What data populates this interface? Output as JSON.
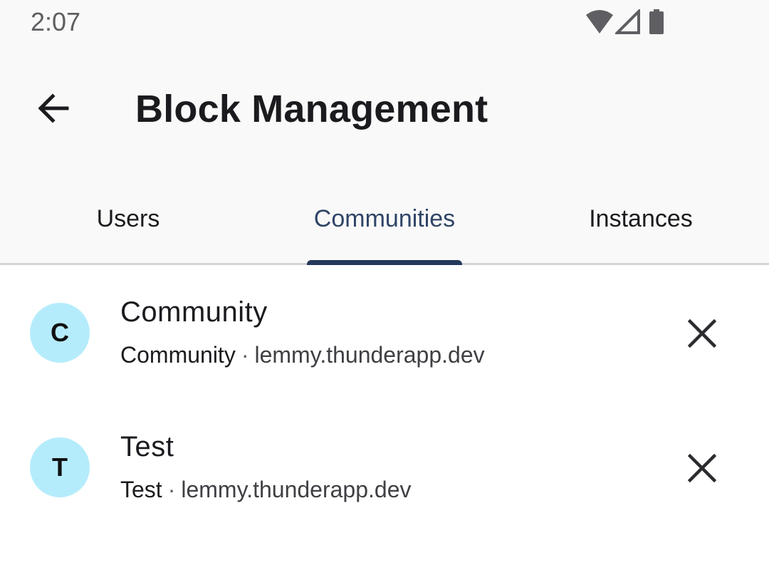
{
  "status_bar": {
    "time": "2:07",
    "icons": [
      "wifi-icon",
      "cellular-signal-icon",
      "battery-icon"
    ]
  },
  "app_bar": {
    "title": "Block Management",
    "back_icon": "arrow-back-icon"
  },
  "tabs": [
    {
      "label": "Users",
      "active": false
    },
    {
      "label": "Communities",
      "active": true
    },
    {
      "label": "Instances",
      "active": false
    }
  ],
  "blocked_communities": [
    {
      "avatar_letter": "C",
      "title": "Community",
      "name": "Community",
      "separator": "·",
      "instance": "lemmy.thunderapp.dev",
      "remove_icon": "close-icon"
    },
    {
      "avatar_letter": "T",
      "title": "Test",
      "name": "Test",
      "separator": "·",
      "instance": "lemmy.thunderapp.dev",
      "remove_icon": "close-icon"
    }
  ],
  "colors": {
    "background": "#ffffff",
    "header_background": "#f9f9f9",
    "accent": "#24385c",
    "active_tab_text": "#2f4566",
    "avatar_background": "#b5ecfc"
  }
}
